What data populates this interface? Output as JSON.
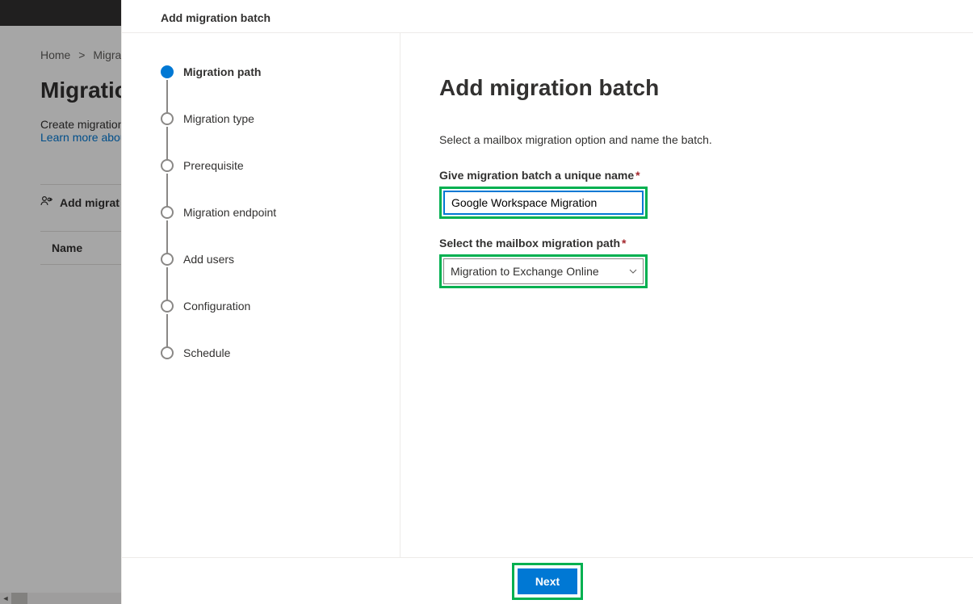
{
  "background": {
    "breadcrumb_home": "Home",
    "breadcrumb_sep": ">",
    "breadcrumb_current": "Migra",
    "title": "Migratio",
    "desc": "Create migration",
    "link": "Learn more abou",
    "add_btn": "Add migrat",
    "table_col_name": "Name"
  },
  "panel": {
    "header": "Add migration batch",
    "steps": [
      "Migration path",
      "Migration type",
      "Prerequisite",
      "Migration endpoint",
      "Add users",
      "Configuration",
      "Schedule"
    ],
    "main_title": "Add migration batch",
    "main_sub": "Select a mailbox migration option and name the batch.",
    "label_name": "Give migration batch a unique name",
    "input_name_value": "Google Workspace Migration",
    "label_path": "Select the mailbox migration path",
    "select_value": "Migration to Exchange Online",
    "next": "Next"
  }
}
